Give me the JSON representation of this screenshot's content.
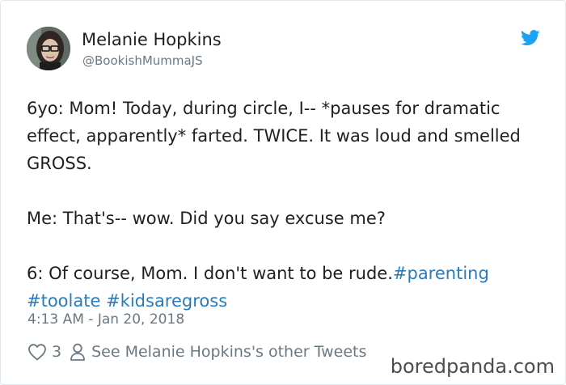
{
  "author": {
    "name": "Melanie Hopkins",
    "handle": "@BookishMummaJS"
  },
  "tweet": {
    "line1": "6yo: Mom! Today, during circle, I-- *pauses for dramatic effect, apparently* farted. TWICE. It was loud and smelled GROSS.",
    "line2": "Me: That's-- wow. Did you say excuse me?",
    "line3_text": "6: Of course, Mom. I don't want to be rude.",
    "hashtags": [
      "#parenting",
      "#toolate",
      "#kidsaregross"
    ]
  },
  "timestamp": "4:13 AM - Jan 20, 2018",
  "actions": {
    "like_count": "3",
    "other_tweets_label": "See Melanie Hopkins's other Tweets"
  },
  "watermark": "boredpanda.com",
  "colors": {
    "link": "#2b7bb9",
    "secondary_text": "#697882",
    "twitter_blue": "#1da1f2"
  },
  "icons": {
    "brand": "twitter-bird-icon",
    "like": "heart-icon",
    "profile": "person-icon"
  }
}
